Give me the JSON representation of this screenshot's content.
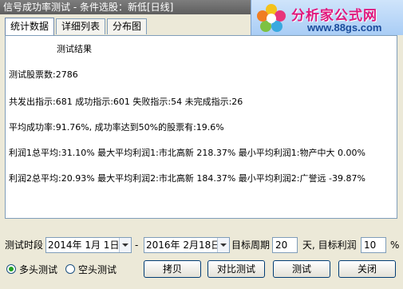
{
  "window": {
    "title": "信号成功率测试 - 条件选股：新低[日线]"
  },
  "logo": {
    "brand": "分析家公式网",
    "url": "www.88gs.com"
  },
  "tabs": [
    {
      "label": "统计数据",
      "active": true
    },
    {
      "label": "详细列表",
      "active": false
    },
    {
      "label": "分布图",
      "active": false
    }
  ],
  "results": {
    "heading": "测试结果",
    "lines": [
      "测试股票数:2786",
      "共发出指示:681 成功指示:601 失败指示:54 未完成指示:26",
      "平均成功率:91.76%, 成功率达到50%的股票有:19.6%",
      "利润1总平均:31.10% 最大平均利润1:市北高新 218.37% 最小平均利润1:物产中大 0.00%",
      "利润2总平均:20.93% 最大平均利润2:市北高新 184.37% 最小平均利润2:广誉远 -39.87%"
    ]
  },
  "controls": {
    "period_label": "测试时段",
    "start_date": "2014年 1月 1日",
    "separator": "-",
    "end_date": "2016年 2月18日",
    "target_period_label": "目标周期",
    "target_period_value": "20",
    "target_profit_label": "天, 目标利润",
    "target_profit_value": "10",
    "percent_sign": "%"
  },
  "mode": {
    "long_label": "多头测试",
    "short_label": "空头测试",
    "selected": "long"
  },
  "buttons": {
    "copy": "拷贝",
    "compare": "对比测试",
    "test": "测试",
    "close": "关闭"
  },
  "colors": {
    "brand_pink": "#e0197d",
    "brand_blue": "#1a4c9c"
  }
}
